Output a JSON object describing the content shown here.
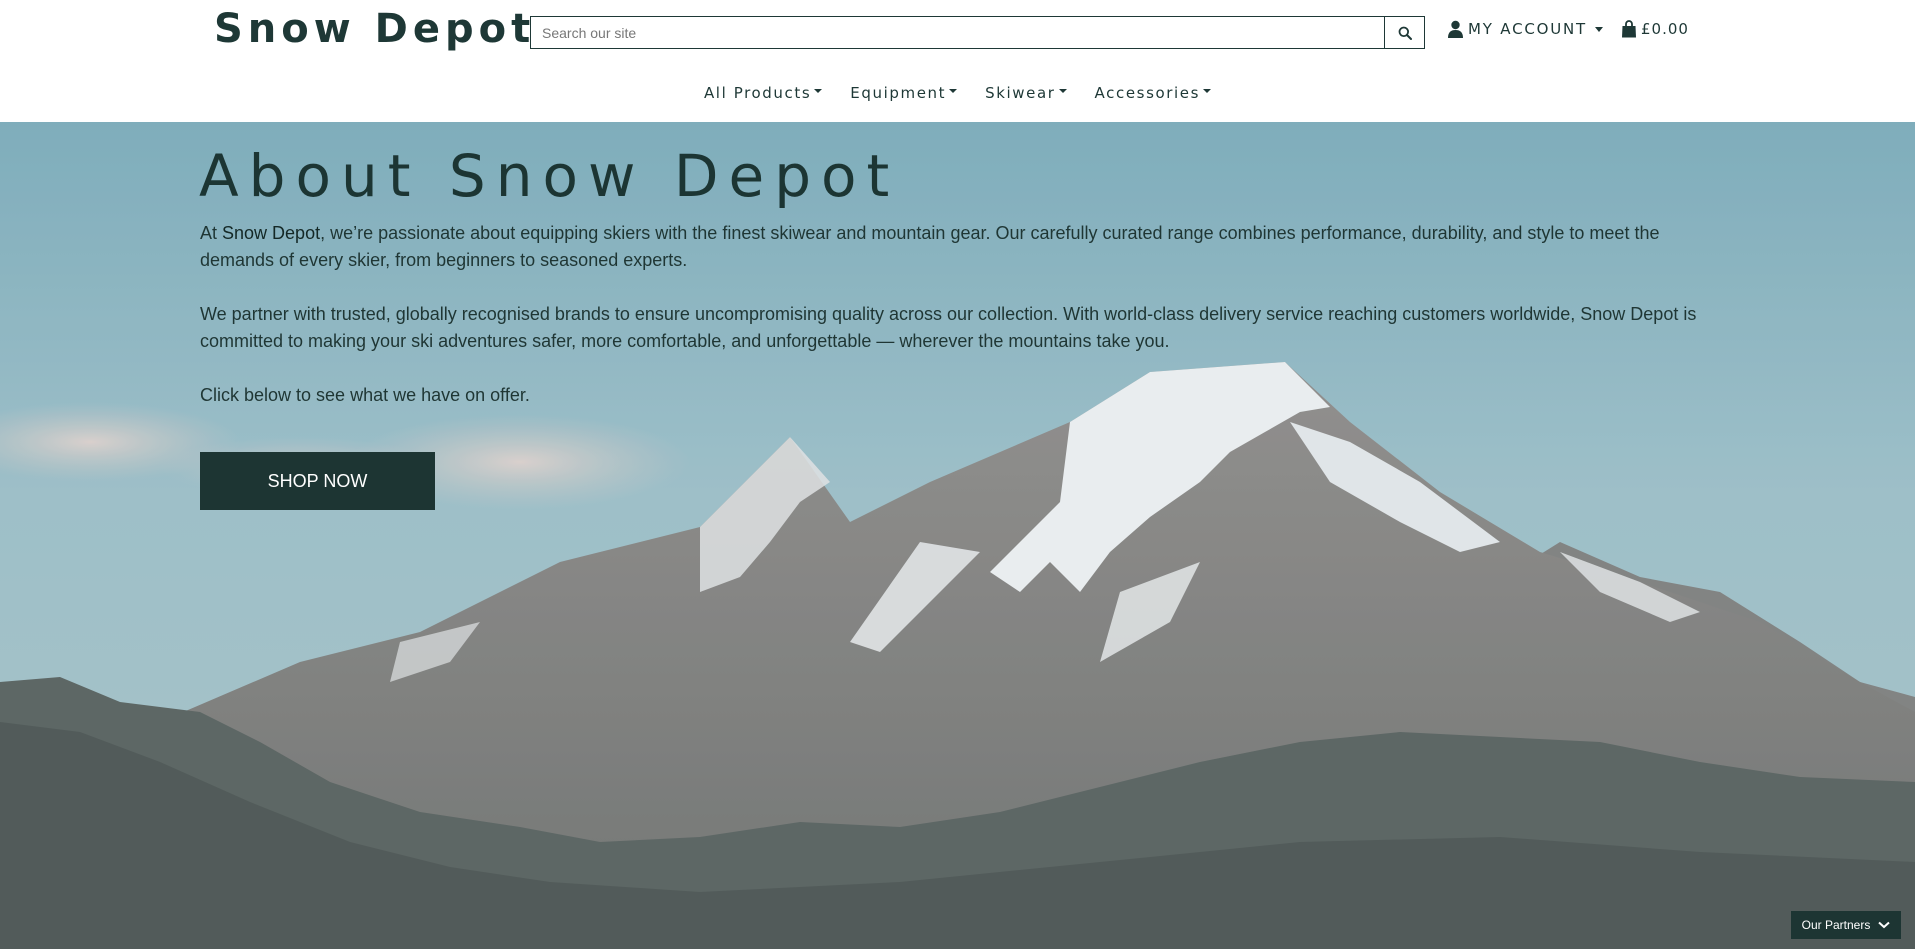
{
  "header": {
    "logo": "Snow Depot",
    "search": {
      "placeholder": "Search our site",
      "value": "",
      "button_icon": "search-icon"
    },
    "account": {
      "label": "MY ACCOUNT",
      "icon": "user-icon"
    },
    "cart": {
      "total": "£0.00",
      "icon": "shopping-bag-icon"
    }
  },
  "nav": {
    "items": [
      {
        "label": "All Products"
      },
      {
        "label": "Equipment"
      },
      {
        "label": "Skiwear"
      },
      {
        "label": "Accessories"
      }
    ]
  },
  "hero": {
    "title": "About Snow Depot",
    "p1_before": "At ",
    "p1_brand": "Snow Depot",
    "p1_after": ", we’re passionate about equipping skiers with the finest skiwear and mountain gear. Our carefully curated range combines performance, durability, and style to meet the demands of every skier, from beginners to seasoned experts.",
    "p2": "We partner with trusted, globally recognised brands to ensure uncompromising quality across our collection. With world-class delivery service reaching customers worldwide, Snow Depot is committed to making your ski adventures safer, more comfortable, and unforgettable — wherever the mountains take you.",
    "p3": "Click below to see what we have on offer.",
    "cta": "SHOP NOW"
  },
  "partners": {
    "label": "Our Partners",
    "icon": "chevron-down-icon"
  },
  "colors": {
    "brand_dark": "#1d3533",
    "sky": "#78a9b8"
  }
}
